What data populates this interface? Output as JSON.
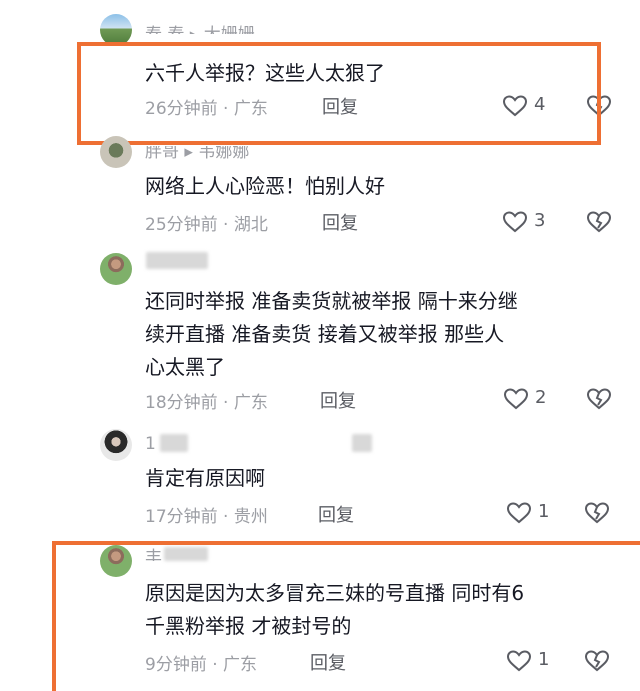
{
  "comments": [
    {
      "user": "春 春 ▸ 大姗姗",
      "text": "六千人举报？这些人太狠了",
      "time_location": "26分钟前 · 广东",
      "reply_label": "回复",
      "likes": "4"
    },
    {
      "user": "胖哥 ▸ 韦娜娜",
      "text": "网络上人心险恶！怕别人好",
      "time_location": "25分钟前 · 湖北",
      "reply_label": "回复",
      "likes": "3"
    },
    {
      "user": "",
      "text_lines": [
        "还同时举报  准备卖货就被举报  隔十来分继",
        "续开直播  准备卖货  接着又被举报  那些人",
        "心太黑了"
      ],
      "time_location": "18分钟前 · 广东",
      "reply_label": "回复",
      "likes": "2"
    },
    {
      "user": "1",
      "text": "肯定有原因啊",
      "time_location": "17分钟前 · 贵州",
      "reply_label": "回复",
      "likes": "1"
    },
    {
      "user": "丰",
      "text_lines": [
        "原因是因为太多冒充三妹的号直播  同时有6",
        "千黑粉举报 才被封号的"
      ],
      "time_location": "9分钟前 · 广东",
      "reply_label": "回复",
      "likes": "1"
    }
  ],
  "colors": {
    "highlight": "#ee6f33",
    "text": "#161823",
    "meta": "#9c9ea4"
  }
}
